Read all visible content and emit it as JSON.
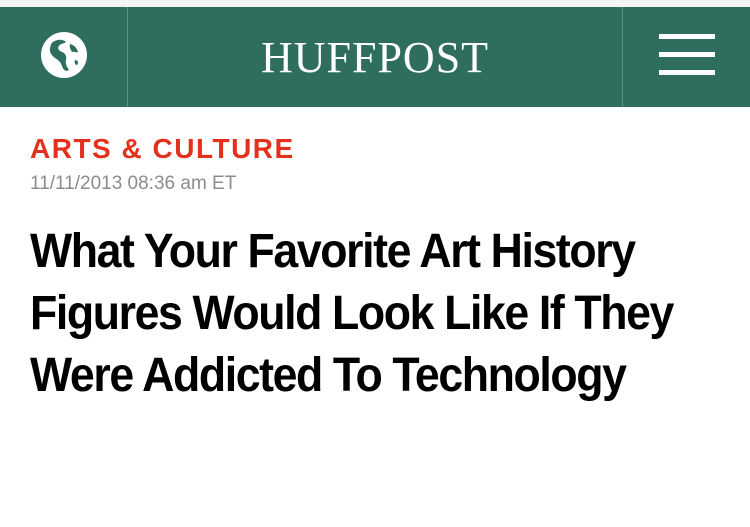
{
  "header": {
    "logo": "HUFFPOST",
    "edition_icon": "globe-icon",
    "menu_icon": "hamburger-menu-icon",
    "background_color": "#2f6e5e"
  },
  "article": {
    "section": "ARTS & CULTURE",
    "section_color": "#e2311d",
    "timestamp": "11/11/2013 08:36 am ET",
    "headline": "What Your Favorite Art History Figures Would Look Like If They Were Addicted To Technology"
  }
}
